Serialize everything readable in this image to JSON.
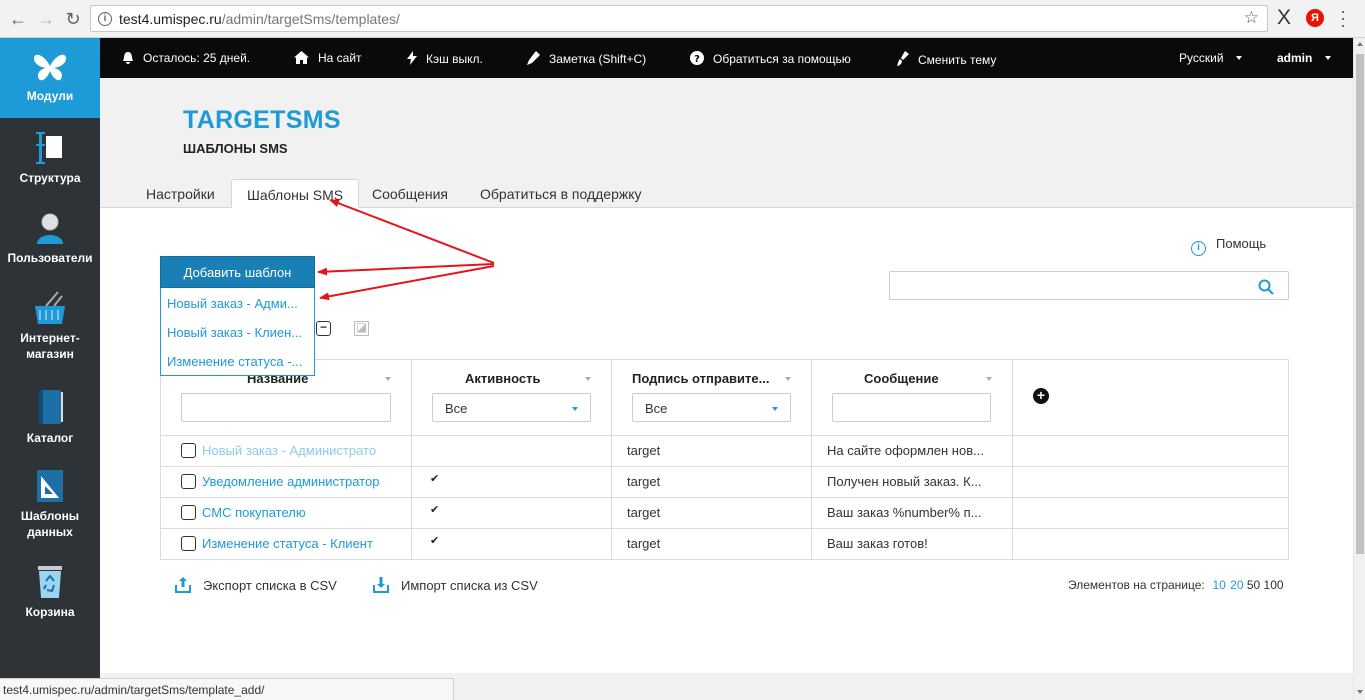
{
  "browser": {
    "url_host": "test4.umispec.ru",
    "url_path": "/admin/targetSms/templates/",
    "status_url": "test4.umispec.ru/admin/targetSms/template_add/",
    "ext_x": "X",
    "ext_ya": "Я"
  },
  "sidebar": {
    "items": [
      {
        "label": "Модули",
        "icon": "butterfly-icon"
      },
      {
        "label": "Структура",
        "icon": "structure-icon"
      },
      {
        "label": "Пользователи",
        "icon": "users-icon"
      },
      {
        "label": "Интернет-магазин",
        "icon": "basket-icon"
      },
      {
        "label": "Каталог",
        "icon": "book-icon"
      },
      {
        "label": "Шаблоны данных",
        "icon": "ruler-icon"
      },
      {
        "label": "Корзина",
        "icon": "recycle-icon"
      }
    ]
  },
  "topbar": {
    "days_left": "Осталось: 25 дней.",
    "to_site": "На сайт",
    "cache": "Кэш выкл.",
    "note": "Заметка (Shift+C)",
    "help": "Обратиться за помощью",
    "theme": "Сменить тему",
    "language": "Русский",
    "user": "admin"
  },
  "header": {
    "title": "TARGETSMS",
    "subtitle": "ШАБЛОНЫ SMS"
  },
  "tabs": [
    {
      "label": "Настройки"
    },
    {
      "label": "Шаблоны SMS"
    },
    {
      "label": "Сообщения"
    },
    {
      "label": "Обратиться в поддержку"
    }
  ],
  "help_link": "Помощь",
  "dropdown": {
    "button": "Добавить шаблон",
    "items": [
      "Новый заказ - Адми...",
      "Новый заказ - Клиен...",
      "Изменение статуса -..."
    ]
  },
  "table": {
    "columns": [
      "Название",
      "Активность",
      "Подпись отправите...",
      "Сообщение"
    ],
    "filter_all": "Все",
    "rows": [
      {
        "name": "Новый заказ - Администрато",
        "active": "",
        "signature": "target",
        "message": "На сайте оформлен нов..."
      },
      {
        "name": "Уведомление администратор",
        "active": "✔",
        "signature": "target",
        "message": "Получен новый заказ. К..."
      },
      {
        "name": "СМС покупателю",
        "active": "✔",
        "signature": "target",
        "message": "Ваш заказ %number% п..."
      },
      {
        "name": "Изменение статуса - Клиент",
        "active": "✔",
        "signature": "target",
        "message": "Ваш заказ готов!"
      }
    ]
  },
  "footer": {
    "export": "Экспорт списка в CSV",
    "import": "Импорт списка из CSV",
    "per_page_label": "Элементов на странице:",
    "per_page": [
      "10",
      "20",
      "50",
      "100"
    ]
  },
  "colors": {
    "accent": "#1e9ad6",
    "sidebar_bg": "#2e3337",
    "topbar_bg": "#0a0a0a",
    "annotation_arrow": "#e8131a"
  }
}
